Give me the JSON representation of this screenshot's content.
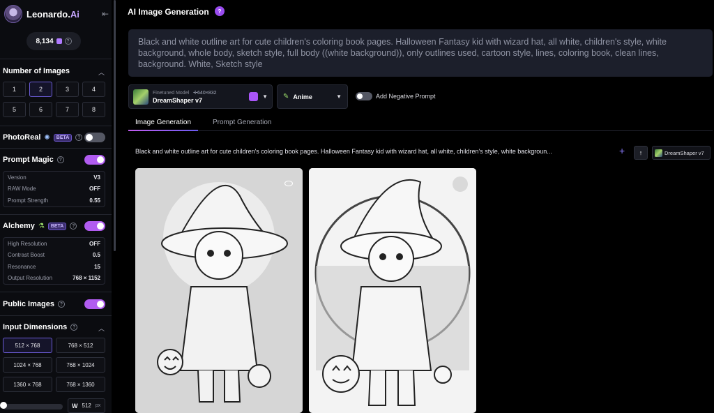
{
  "app": {
    "name": "Leonardo.",
    "name_suffix": "Ai",
    "tokens": "8,134"
  },
  "sidebar": {
    "number_of_images": {
      "title": "Number of Images",
      "options": [
        "1",
        "2",
        "3",
        "4",
        "5",
        "6",
        "7",
        "8"
      ],
      "selected": "2"
    },
    "photoreal": {
      "label": "PhotoReal",
      "beta": "BETA",
      "enabled": false
    },
    "prompt_magic": {
      "label": "Prompt Magic",
      "enabled": true,
      "rows": [
        {
          "key": "Version",
          "value": "V3"
        },
        {
          "key": "RAW Mode",
          "value": "OFF"
        },
        {
          "key": "Prompt Strength",
          "value": "0.55"
        }
      ]
    },
    "alchemy": {
      "label": "Alchemy",
      "beta": "BETA",
      "enabled": true,
      "rows": [
        {
          "key": "High Resolution",
          "value": "OFF"
        },
        {
          "key": "Contrast Boost",
          "value": "0.5"
        },
        {
          "key": "Resonance",
          "value": "15"
        },
        {
          "key": "Output Resolution",
          "value": "768 × 1152"
        }
      ]
    },
    "public_images": {
      "label": "Public Images",
      "enabled": true
    },
    "input_dimensions": {
      "title": "Input Dimensions",
      "options": [
        "512 × 768",
        "768 × 512",
        "1024 × 768",
        "768 × 1024",
        "1360 × 768",
        "768 × 1360"
      ],
      "selected": "512 × 768"
    },
    "width": {
      "label": "W",
      "value": "512",
      "unit": "px"
    }
  },
  "main": {
    "title": "AI Image Generation",
    "prompt": "Black and white outline art for cute children's coloring book pages. Halloween Fantasy kid with wizard hat, all white, children's style, white background, whole body, sketch style, full body ((white background)), only outlines used, cartoon style, lines, coloring book, clean lines, background. White, Sketch style",
    "model": {
      "label": "Finetuned Model",
      "resolution": "640×832",
      "name": "DreamShaper v7"
    },
    "style": {
      "name": "Anime"
    },
    "negative_prompt": {
      "label": "Add Negative Prompt",
      "enabled": false
    },
    "tabs": [
      {
        "label": "Image Generation",
        "active": true
      },
      {
        "label": "Prompt Generation",
        "active": false
      }
    ],
    "generation": {
      "prompt_preview": "Black and white outline art for cute children's coloring book pages. Halloween Fantasy kid with wizard hat, all white, children's style, white backgroun...",
      "model_chip": "DreamShaper v7"
    }
  },
  "icons": {
    "collapse": "collapse-sidebar-icon",
    "help": "help-icon",
    "plus": "plus-icon",
    "reuse": "arrow-up-icon",
    "eye": "eye-icon"
  },
  "colors": {
    "accent": "#b15cf0",
    "bg": "#000000",
    "panel": "#1c1f2b"
  }
}
